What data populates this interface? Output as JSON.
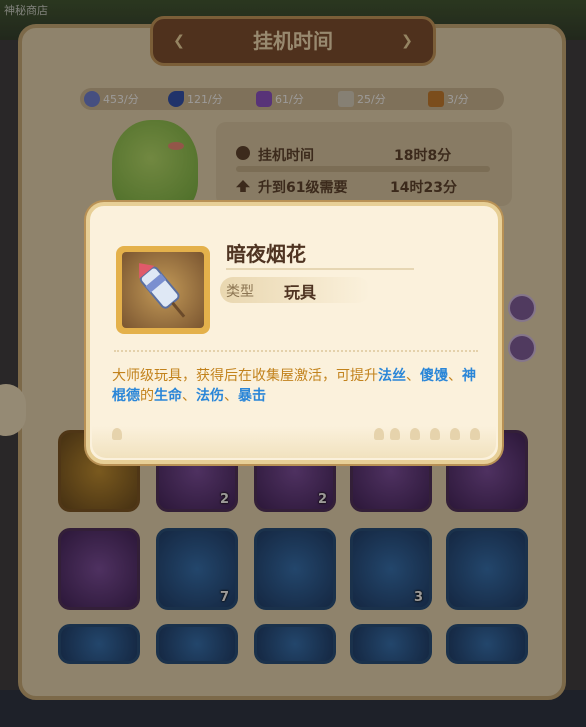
{
  "top_left_label": "神秘商店",
  "title": "挂机时间",
  "rates": [
    {
      "icon": "crystal-icon",
      "value": "453/分",
      "color": "#6b7fd6"
    },
    {
      "icon": "moon-icon",
      "value": "121/分",
      "color": "#2c4fb0"
    },
    {
      "icon": "potion-icon",
      "value": "61/分",
      "color": "#8a4fc8"
    },
    {
      "icon": "scroll-icon",
      "value": "25/分",
      "color": "#d9d2c2"
    },
    {
      "icon": "map-icon",
      "value": "3/分",
      "color": "#c77a2a"
    }
  ],
  "afk": {
    "time_label": "挂机时间",
    "time_value": "18时8分",
    "next_label": "升到61级需要",
    "next_value": "14时23分"
  },
  "popup": {
    "item_name": "暗夜烟花",
    "type_label": "类型",
    "type_value": "玩具",
    "desc_parts": [
      {
        "text": "大师级玩具，获得后在收集屋激活，可提升",
        "hl": false
      },
      {
        "text": "法丝",
        "hl": true
      },
      {
        "text": "、",
        "hl": false
      },
      {
        "text": "傻馒",
        "hl": true
      },
      {
        "text": "、",
        "hl": false
      },
      {
        "text": "神棍德",
        "hl": true
      },
      {
        "text": "的",
        "hl": false
      },
      {
        "text": "生命",
        "hl": true
      },
      {
        "text": "、",
        "hl": false
      },
      {
        "text": "法伤",
        "hl": true
      },
      {
        "text": "、",
        "hl": false
      },
      {
        "text": "暴击",
        "hl": true
      }
    ]
  },
  "grid": {
    "row1_counts": [
      "",
      "2",
      "2",
      "",
      ""
    ],
    "row2_counts": [
      "",
      "7",
      "",
      "3",
      ""
    ]
  },
  "colors": {
    "highlight": "#2a86d8",
    "desc_text": "#c2821c",
    "banner": "#7a4b2c"
  }
}
